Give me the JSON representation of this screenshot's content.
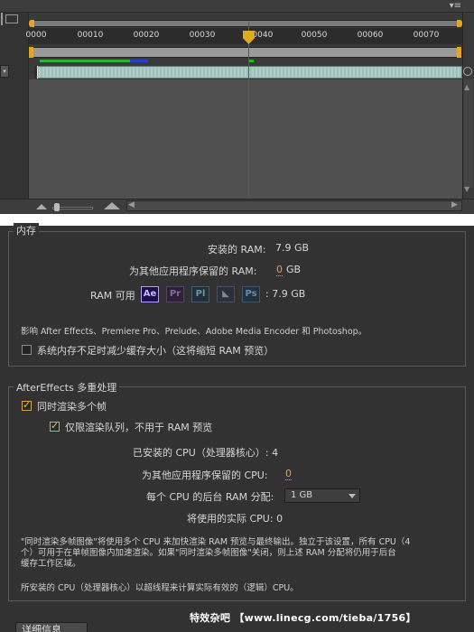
{
  "timeline": {
    "ruler_labels": [
      "0000",
      "00010",
      "00020",
      "00030",
      "00040",
      "00050",
      "00060",
      "00070"
    ],
    "cti_frame": "00039"
  },
  "memory": {
    "section_title": "内存",
    "installed_ram_label": "安装的 RAM:",
    "installed_ram_value": "7.9 GB",
    "reserved_ram_label": "为其他应用程序保留的 RAM:",
    "reserved_ram_value": "0",
    "reserved_ram_unit": "GB",
    "ram_available_label": "RAM 可用",
    "apps": [
      "Ae",
      "Pr",
      "Pl",
      "Me",
      "Ps"
    ],
    "ram_available_value": ": 7.9 GB",
    "affects_note": "影响 After Effects、Premiere Pro、Prelude、Adobe Media Encoder 和 Photoshop。",
    "reduce_cache_label": "系统内存不足时减少缓存大小（这将缩短 RAM 预览）",
    "reduce_cache_checked": false
  },
  "multiprocessing": {
    "section_title": "AfterEffects 多重处理",
    "render_multiple_frames_label": "同时渲染多个帧",
    "render_multiple_frames_checked": true,
    "render_queue_only_label": "仅限渲染队列，不用于 RAM 预览",
    "render_queue_only_checked": true,
    "installed_cpus_label": "已安装的 CPU（处理器核心）: 4",
    "reserved_cpus_label": "为其他应用程序保留的 CPU:",
    "reserved_cpus_value": "0",
    "ram_per_cpu_label": "每个 CPU 的后台 RAM 分配:",
    "ram_per_cpu_value": "1 GB",
    "actual_cpus_label": "将使用的实际 CPU: 0",
    "note_line1": "\"同时渲染多帧图像\"将使用多个 CPU 来加快渲染 RAM 预览与最终输出。独立于该设置，所有 CPU（4",
    "note_line2": "个）可用于在单帧图像内加速渲染。如果\"同时渲染多帧图像\"关闭，则上述 RAM 分配将仍用于后台",
    "note_line3": "缓存工作区域。",
    "logical_note": "所安装的 CPU（处理器核心）以超线程来计算实际有效的（逻辑）CPU。"
  },
  "watermark": "特效杂吧 【www.linecg.com/tieba/1756】",
  "details_button_label": "详细信息"
}
